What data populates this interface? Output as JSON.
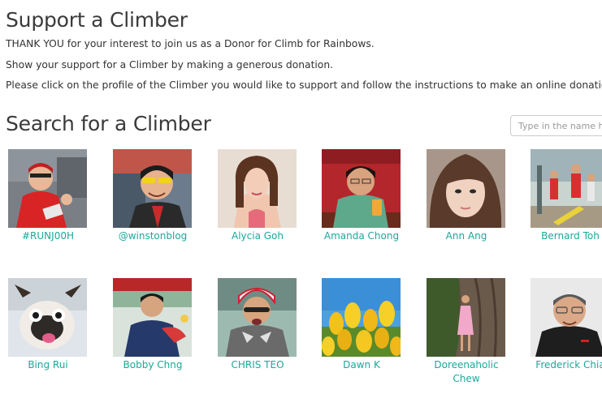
{
  "page": {
    "title": "Support a Climber",
    "intro": [
      "THANK YOU for your interest to join us as a Donor for Climb for Rainbows.",
      "Show your support for a Climber by making a generous donation.",
      "Please click on the profile of the Climber you would like to support and follow the instructions to make an online donation."
    ]
  },
  "search": {
    "title": "Search for a Climber",
    "placeholder": "Type in the name here"
  },
  "climbers": [
    {
      "name": "#RUNJ00H"
    },
    {
      "name": "@winstonblog"
    },
    {
      "name": "Alycia Goh"
    },
    {
      "name": "Amanda Chong"
    },
    {
      "name": "Ann Ang"
    },
    {
      "name": "Bernard Toh"
    },
    {
      "name": "Bing Rui"
    },
    {
      "name": "Bobby Chng"
    },
    {
      "name": "CHRIS TEO"
    },
    {
      "name": "Dawn K"
    },
    {
      "name": "Doreenaholic\nChew"
    },
    {
      "name": "Frederick Chia"
    }
  ],
  "colors": {
    "link": "#1ba89b",
    "heading": "#3a3a3a"
  }
}
